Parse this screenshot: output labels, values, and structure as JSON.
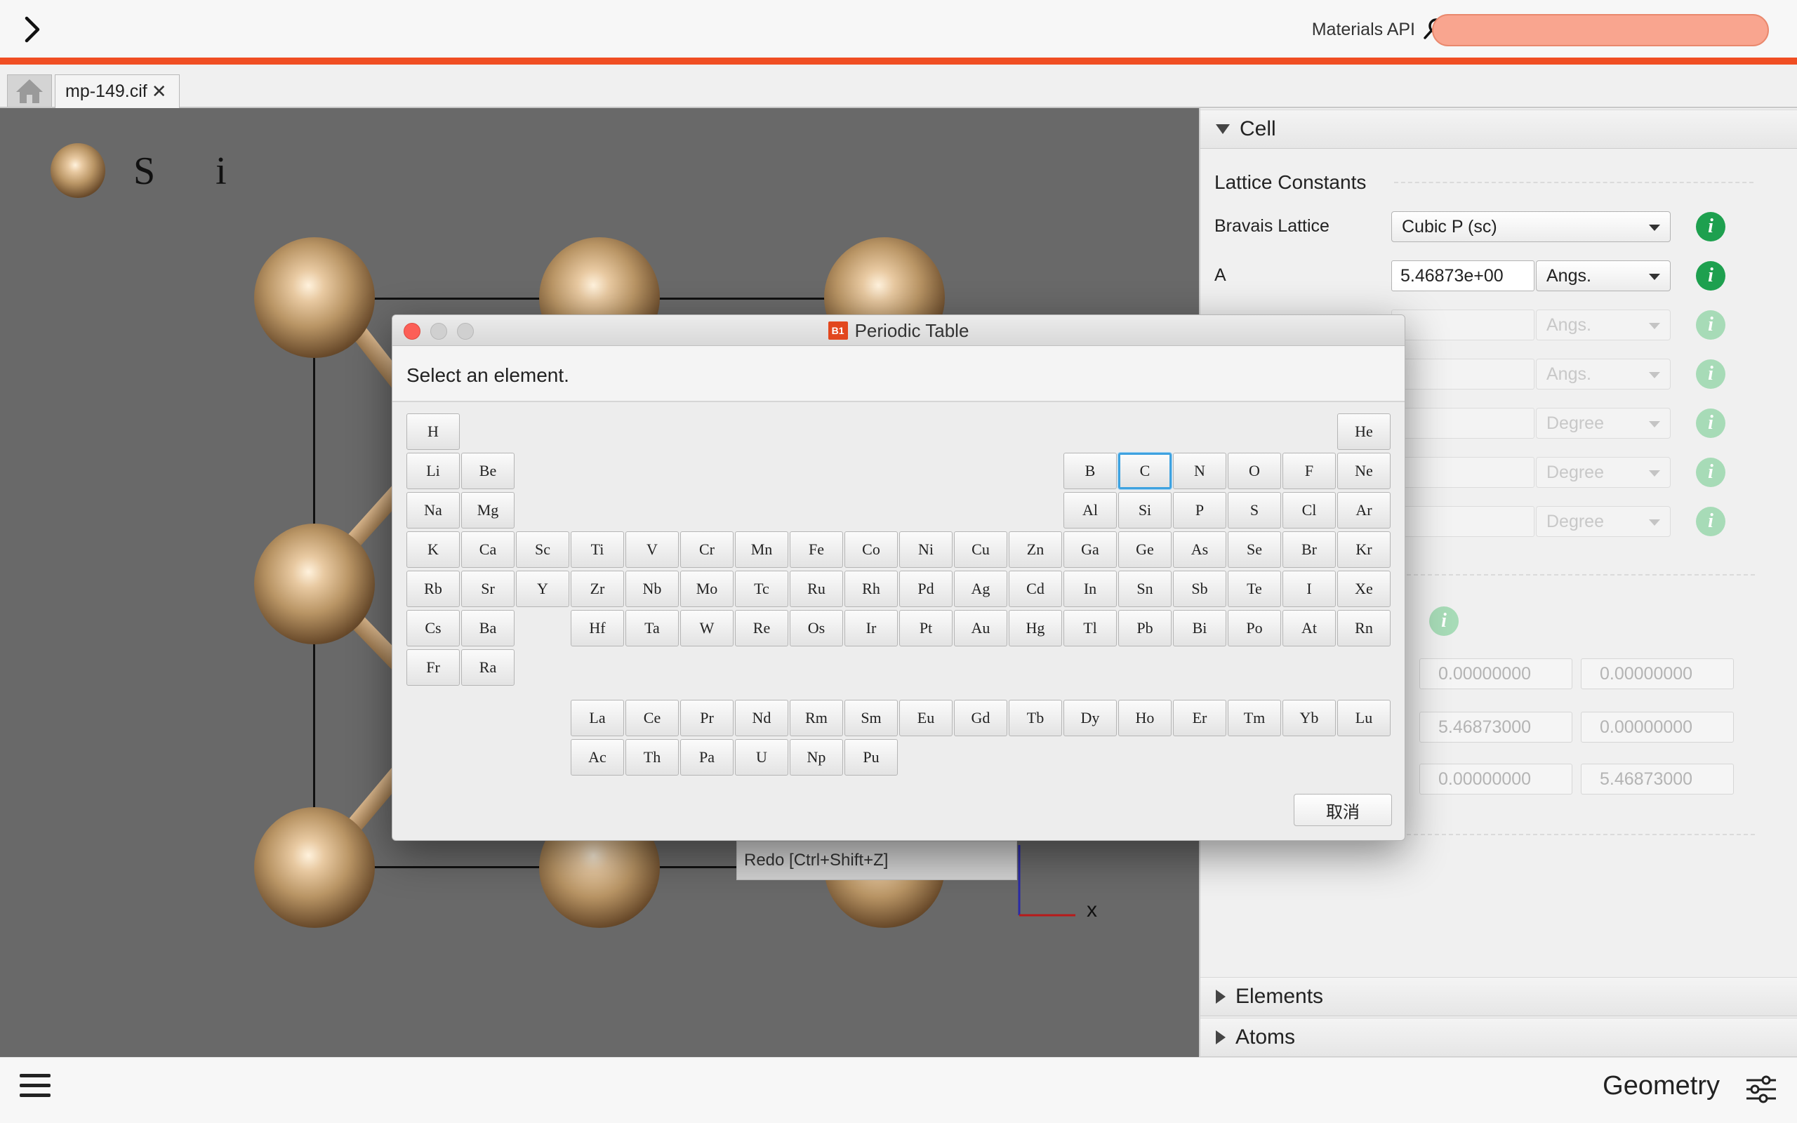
{
  "topbar": {
    "api_label": "Materials API",
    "api_key_value": ""
  },
  "tabs": {
    "home_icon": "home-icon",
    "file_tab": "mp-149.cif",
    "close_glyph": "✕"
  },
  "viewer": {
    "legend_label": "S i",
    "context_menu_item": "Redo [Ctrl+Shift+Z]",
    "axis_x_label": "x"
  },
  "panel": {
    "sections": {
      "cell": "Cell",
      "elements": "Elements",
      "atoms": "Atoms"
    },
    "lattice_constants_heading": "Lattice Constants",
    "bravais_label": "Bravais Lattice",
    "bravais_value": "Cubic P (sc)",
    "a_label": "A",
    "a_value": "5.46873e+00",
    "a_unit": "Angs.",
    "disabled_units": [
      "Angs.",
      "Angs.",
      "Degree",
      "Degree",
      "Degree"
    ],
    "info_glyph": "i",
    "vector_matrix": [
      [
        "0.00000000",
        "0.00000000"
      ],
      [
        "5.46873000",
        "0.00000000"
      ],
      [
        "0.00000000",
        "5.46873000"
      ]
    ]
  },
  "dialog": {
    "title": "Periodic Table",
    "app_badge": "B1",
    "prompt": "Select an element.",
    "cancel_label": "取消",
    "selected_element": "C",
    "elements": [
      {
        "s": "H",
        "r": 1,
        "c": 1
      },
      {
        "s": "He",
        "r": 1,
        "c": 18
      },
      {
        "s": "Li",
        "r": 2,
        "c": 1
      },
      {
        "s": "Be",
        "r": 2,
        "c": 2
      },
      {
        "s": "B",
        "r": 2,
        "c": 13
      },
      {
        "s": "C",
        "r": 2,
        "c": 14
      },
      {
        "s": "N",
        "r": 2,
        "c": 15
      },
      {
        "s": "O",
        "r": 2,
        "c": 16
      },
      {
        "s": "F",
        "r": 2,
        "c": 17
      },
      {
        "s": "Ne",
        "r": 2,
        "c": 18
      },
      {
        "s": "Na",
        "r": 3,
        "c": 1
      },
      {
        "s": "Mg",
        "r": 3,
        "c": 2
      },
      {
        "s": "Al",
        "r": 3,
        "c": 13
      },
      {
        "s": "Si",
        "r": 3,
        "c": 14
      },
      {
        "s": "P",
        "r": 3,
        "c": 15
      },
      {
        "s": "S",
        "r": 3,
        "c": 16
      },
      {
        "s": "Cl",
        "r": 3,
        "c": 17
      },
      {
        "s": "Ar",
        "r": 3,
        "c": 18
      },
      {
        "s": "K",
        "r": 4,
        "c": 1
      },
      {
        "s": "Ca",
        "r": 4,
        "c": 2
      },
      {
        "s": "Sc",
        "r": 4,
        "c": 3
      },
      {
        "s": "Ti",
        "r": 4,
        "c": 4
      },
      {
        "s": "V",
        "r": 4,
        "c": 5
      },
      {
        "s": "Cr",
        "r": 4,
        "c": 6
      },
      {
        "s": "Mn",
        "r": 4,
        "c": 7
      },
      {
        "s": "Fe",
        "r": 4,
        "c": 8
      },
      {
        "s": "Co",
        "r": 4,
        "c": 9
      },
      {
        "s": "Ni",
        "r": 4,
        "c": 10
      },
      {
        "s": "Cu",
        "r": 4,
        "c": 11
      },
      {
        "s": "Zn",
        "r": 4,
        "c": 12
      },
      {
        "s": "Ga",
        "r": 4,
        "c": 13
      },
      {
        "s": "Ge",
        "r": 4,
        "c": 14
      },
      {
        "s": "As",
        "r": 4,
        "c": 15
      },
      {
        "s": "Se",
        "r": 4,
        "c": 16
      },
      {
        "s": "Br",
        "r": 4,
        "c": 17
      },
      {
        "s": "Kr",
        "r": 4,
        "c": 18
      },
      {
        "s": "Rb",
        "r": 5,
        "c": 1
      },
      {
        "s": "Sr",
        "r": 5,
        "c": 2
      },
      {
        "s": "Y",
        "r": 5,
        "c": 3
      },
      {
        "s": "Zr",
        "r": 5,
        "c": 4
      },
      {
        "s": "Nb",
        "r": 5,
        "c": 5
      },
      {
        "s": "Mo",
        "r": 5,
        "c": 6
      },
      {
        "s": "Tc",
        "r": 5,
        "c": 7
      },
      {
        "s": "Ru",
        "r": 5,
        "c": 8
      },
      {
        "s": "Rh",
        "r": 5,
        "c": 9
      },
      {
        "s": "Pd",
        "r": 5,
        "c": 10
      },
      {
        "s": "Ag",
        "r": 5,
        "c": 11
      },
      {
        "s": "Cd",
        "r": 5,
        "c": 12
      },
      {
        "s": "In",
        "r": 5,
        "c": 13
      },
      {
        "s": "Sn",
        "r": 5,
        "c": 14
      },
      {
        "s": "Sb",
        "r": 5,
        "c": 15
      },
      {
        "s": "Te",
        "r": 5,
        "c": 16
      },
      {
        "s": "I",
        "r": 5,
        "c": 17
      },
      {
        "s": "Xe",
        "r": 5,
        "c": 18
      },
      {
        "s": "Cs",
        "r": 6,
        "c": 1
      },
      {
        "s": "Ba",
        "r": 6,
        "c": 2
      },
      {
        "s": "Hf",
        "r": 6,
        "c": 4
      },
      {
        "s": "Ta",
        "r": 6,
        "c": 5
      },
      {
        "s": "W",
        "r": 6,
        "c": 6
      },
      {
        "s": "Re",
        "r": 6,
        "c": 7
      },
      {
        "s": "Os",
        "r": 6,
        "c": 8
      },
      {
        "s": "Ir",
        "r": 6,
        "c": 9
      },
      {
        "s": "Pt",
        "r": 6,
        "c": 10
      },
      {
        "s": "Au",
        "r": 6,
        "c": 11
      },
      {
        "s": "Hg",
        "r": 6,
        "c": 12
      },
      {
        "s": "Tl",
        "r": 6,
        "c": 13
      },
      {
        "s": "Pb",
        "r": 6,
        "c": 14
      },
      {
        "s": "Bi",
        "r": 6,
        "c": 15
      },
      {
        "s": "Po",
        "r": 6,
        "c": 16
      },
      {
        "s": "At",
        "r": 6,
        "c": 17
      },
      {
        "s": "Rn",
        "r": 6,
        "c": 18
      },
      {
        "s": "Fr",
        "r": 7,
        "c": 1
      },
      {
        "s": "Ra",
        "r": 7,
        "c": 2
      },
      {
        "s": "La",
        "r": 8,
        "c": 4
      },
      {
        "s": "Ce",
        "r": 8,
        "c": 5
      },
      {
        "s": "Pr",
        "r": 8,
        "c": 6
      },
      {
        "s": "Nd",
        "r": 8,
        "c": 7
      },
      {
        "s": "Rm",
        "r": 8,
        "c": 8
      },
      {
        "s": "Sm",
        "r": 8,
        "c": 9
      },
      {
        "s": "Eu",
        "r": 8,
        "c": 10
      },
      {
        "s": "Gd",
        "r": 8,
        "c": 11
      },
      {
        "s": "Tb",
        "r": 8,
        "c": 12
      },
      {
        "s": "Dy",
        "r": 8,
        "c": 13
      },
      {
        "s": "Ho",
        "r": 8,
        "c": 14
      },
      {
        "s": "Er",
        "r": 8,
        "c": 15
      },
      {
        "s": "Tm",
        "r": 8,
        "c": 16
      },
      {
        "s": "Yb",
        "r": 8,
        "c": 17
      },
      {
        "s": "Lu",
        "r": 8,
        "c": 18
      },
      {
        "s": "Ac",
        "r": 9,
        "c": 4
      },
      {
        "s": "Th",
        "r": 9,
        "c": 5
      },
      {
        "s": "Pa",
        "r": 9,
        "c": 6
      },
      {
        "s": "U",
        "r": 9,
        "c": 7
      },
      {
        "s": "Np",
        "r": 9,
        "c": 8
      },
      {
        "s": "Pu",
        "r": 9,
        "c": 9
      }
    ]
  },
  "bottombar": {
    "mode_label": "Geometry"
  }
}
